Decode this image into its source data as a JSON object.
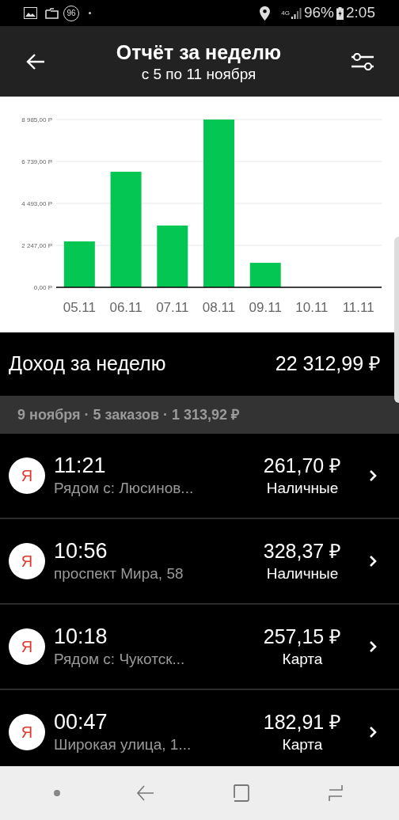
{
  "status_bar": {
    "badge": "96",
    "network": "4G",
    "battery": "96%",
    "time": "2:05"
  },
  "header": {
    "title": "Отчёт за неделю",
    "subtitle": "с 5 по 11 ноября"
  },
  "chart_data": {
    "type": "bar",
    "categories": [
      "05.11",
      "06.11",
      "07.11",
      "08.11",
      "09.11",
      "10.11",
      "11.11"
    ],
    "values": [
      2460,
      6190,
      3310,
      8985,
      1310,
      0,
      0
    ],
    "grid": true,
    "ylim": [
      0,
      8985
    ],
    "yticks": [
      {
        "value": 0,
        "label": "0,00 Р"
      },
      {
        "value": 2247,
        "label": "2 247,00 Р"
      },
      {
        "value": 4493,
        "label": "4 493,00 Р"
      },
      {
        "value": 6739,
        "label": "6 739,00 Р"
      },
      {
        "value": 8985,
        "label": "8 985,00 Р"
      }
    ]
  },
  "income": {
    "label": "Доход за неделю",
    "amount": "22 312,99 ₽"
  },
  "day_header": "9 ноября · 5 заказов · 1 313,92 ₽",
  "orders": [
    {
      "logo": "Я",
      "time": "11:21",
      "address": "Рядом с: Люсинов...",
      "amount": "261,70 ₽",
      "payment": "Наличные"
    },
    {
      "logo": "Я",
      "time": "10:56",
      "address": "проспект Мира, 58",
      "amount": "328,37 ₽",
      "payment": "Наличные"
    },
    {
      "logo": "Я",
      "time": "10:18",
      "address": "Рядом с: Чукотск...",
      "amount": "257,15 ₽",
      "payment": "Карта"
    },
    {
      "logo": "Я",
      "time": "00:47",
      "address": "Широкая улица, 1...",
      "amount": "182,91 ₽",
      "payment": "Карта"
    }
  ]
}
